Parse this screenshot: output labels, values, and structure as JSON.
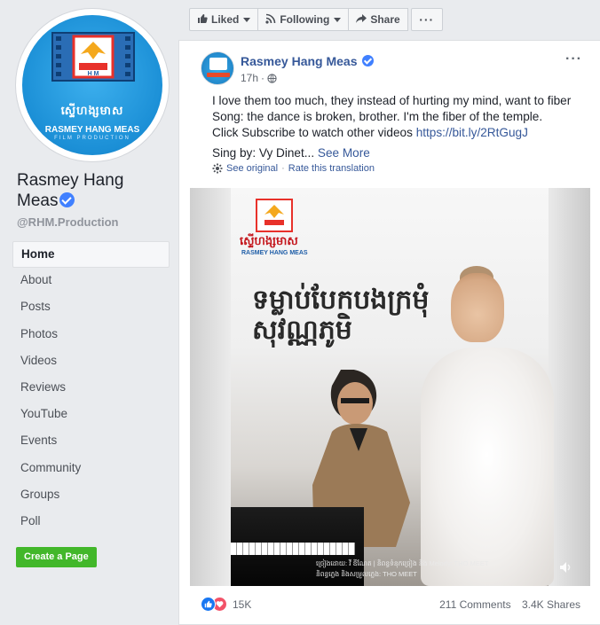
{
  "sidebar": {
    "avatar": {
      "khmer_text": "ស្ទើហង្សមាស",
      "name_text": "RASMEY HANG MEAS",
      "sub_text": "FILM PRODUCTION"
    },
    "page_name": "Rasmey Hang Meas",
    "handle": "@RHM.Production",
    "nav": [
      {
        "label": "Home",
        "active": true
      },
      {
        "label": "About"
      },
      {
        "label": "Posts"
      },
      {
        "label": "Photos"
      },
      {
        "label": "Videos"
      },
      {
        "label": "Reviews"
      },
      {
        "label": "YouTube"
      },
      {
        "label": "Events"
      },
      {
        "label": "Community"
      },
      {
        "label": "Groups"
      },
      {
        "label": "Poll"
      }
    ],
    "create_page_label": "Create a Page"
  },
  "actionbar": {
    "liked_label": "Liked",
    "following_label": "Following",
    "share_label": "Share",
    "more_label": "···"
  },
  "post": {
    "author": "Rasmey Hang Meas",
    "time": "17h",
    "menu_label": "···",
    "text_line1": "I love them too much, they instead of hurting my mind, want to fiber",
    "text_line2": "Song: the dance is broken, brother. I'm the fiber of the temple.",
    "text_line3_prefix": "Click Subscribe to watch other videos ",
    "link": "https://bit.ly/2RtGugJ",
    "text_line4": "Sing by: Vy Dinet...",
    "see_more": "See More",
    "see_original": "See original",
    "separator": "·",
    "rate_translation": "Rate this translation",
    "media": {
      "logo_khmer": "ស្ទើហង្សមាស",
      "logo_en": "RASMEY HANG MEAS",
      "title_khmer": "ទម្លាប់បែកបងក្រមុំសុវណ្ណភូមិ",
      "credit_line1": "ច្រៀងដោយ: វី ឌីណែត | និពន្ធទំនុកច្រៀង និង Melody: THO MEET",
      "credit_line2": "និពន្ធភ្លេង និងសម្រួលភ្លេង: THO MEET"
    },
    "reactions_count": "15K",
    "comments": "211 Comments",
    "shares": "3.4K Shares"
  },
  "colors": {
    "link": "#365899",
    "like_blue": "#1877f2",
    "love_red": "#f25268",
    "create_green": "#42b72a",
    "page_bg": "#e9ebee"
  }
}
